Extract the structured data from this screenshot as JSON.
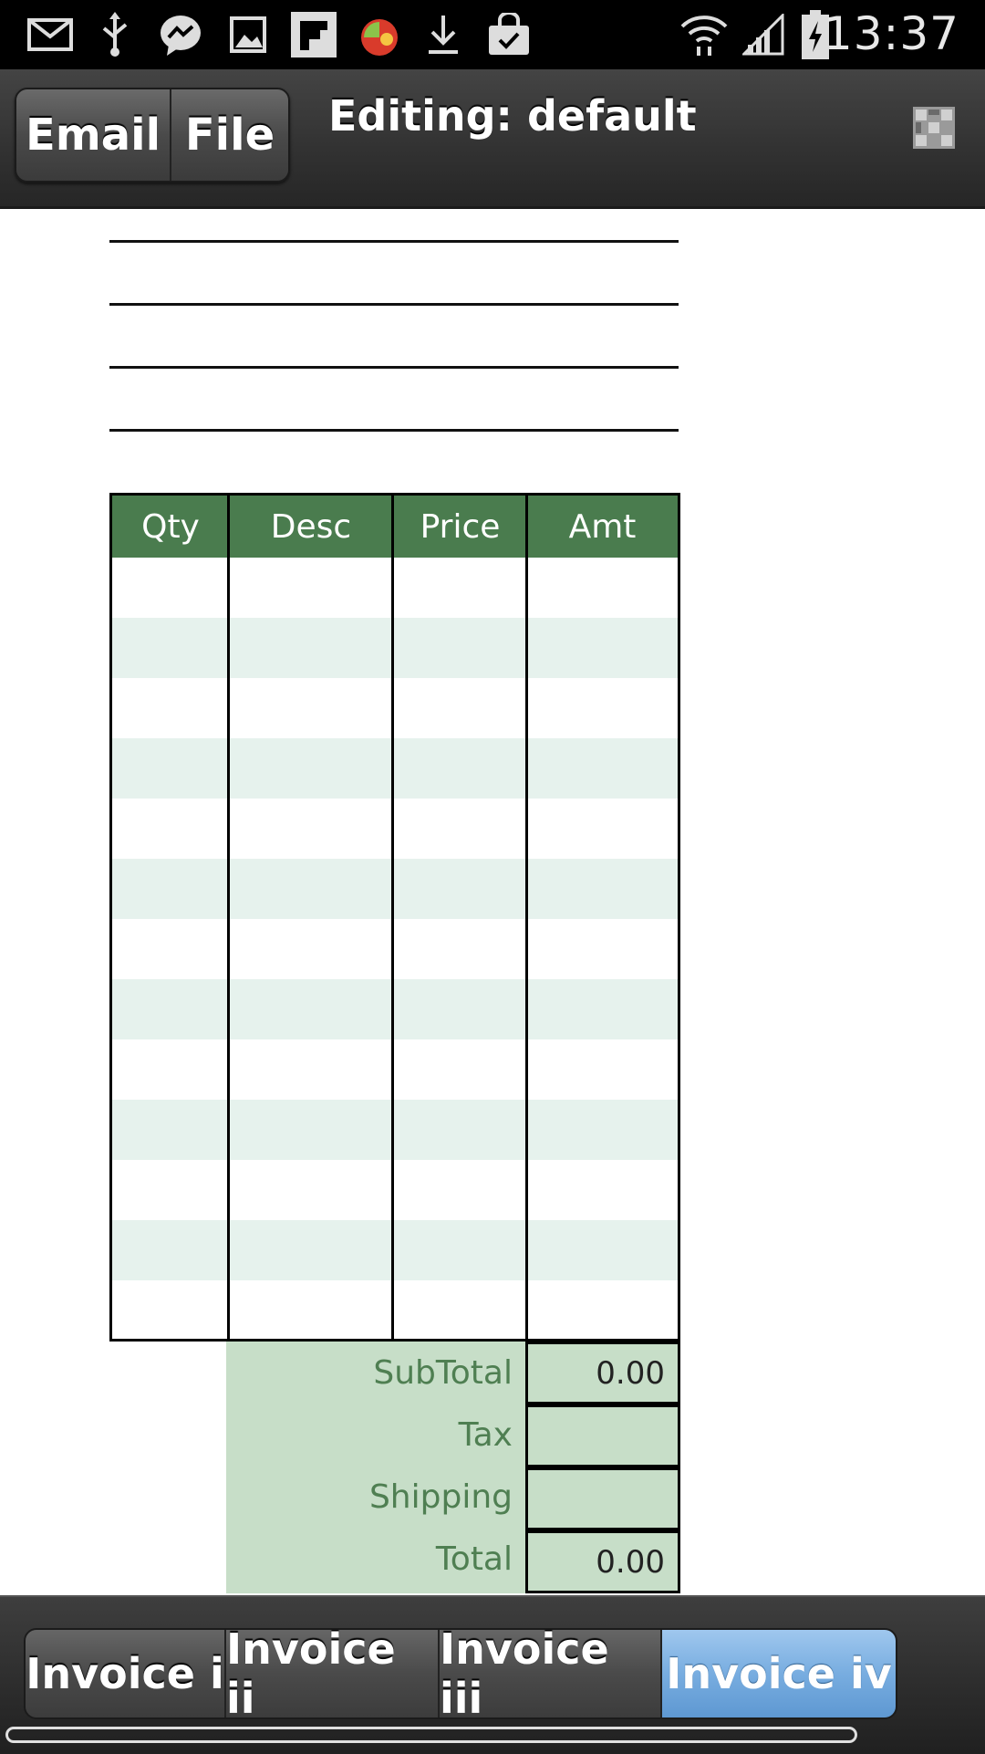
{
  "status_bar": {
    "time": "13:37",
    "icons": [
      "email-icon",
      "usb-icon",
      "messenger-icon",
      "image-icon",
      "flipboard-icon",
      "fruit-app-icon",
      "download-icon",
      "shopping-bag-icon",
      "wifi-icon",
      "signal-icon",
      "battery-charging-icon"
    ]
  },
  "action_bar": {
    "email_label": "Email",
    "file_label": "File",
    "title": "Editing: default",
    "menu_icon": "grid-menu-icon"
  },
  "invoice_table": {
    "headers": [
      "Qty",
      "Desc",
      "Price",
      "Amt"
    ],
    "row_count": 13,
    "header_color": "#4a7c4e",
    "alt_row_color": "#e6f2ed"
  },
  "totals": {
    "subtotal_label": "SubTotal",
    "subtotal_value": "0.00",
    "tax_label": "Tax",
    "tax_value": "",
    "shipping_label": "Shipping",
    "shipping_value": "",
    "total_label": "Total",
    "total_value": "0.00"
  },
  "tabs": {
    "items": [
      {
        "label": "Invoice i",
        "active": false
      },
      {
        "label": "Invoice ii",
        "active": false
      },
      {
        "label": "Invoice iii",
        "active": false
      },
      {
        "label": "Invoice iv",
        "active": true
      }
    ],
    "active_color": "#78ade0"
  }
}
